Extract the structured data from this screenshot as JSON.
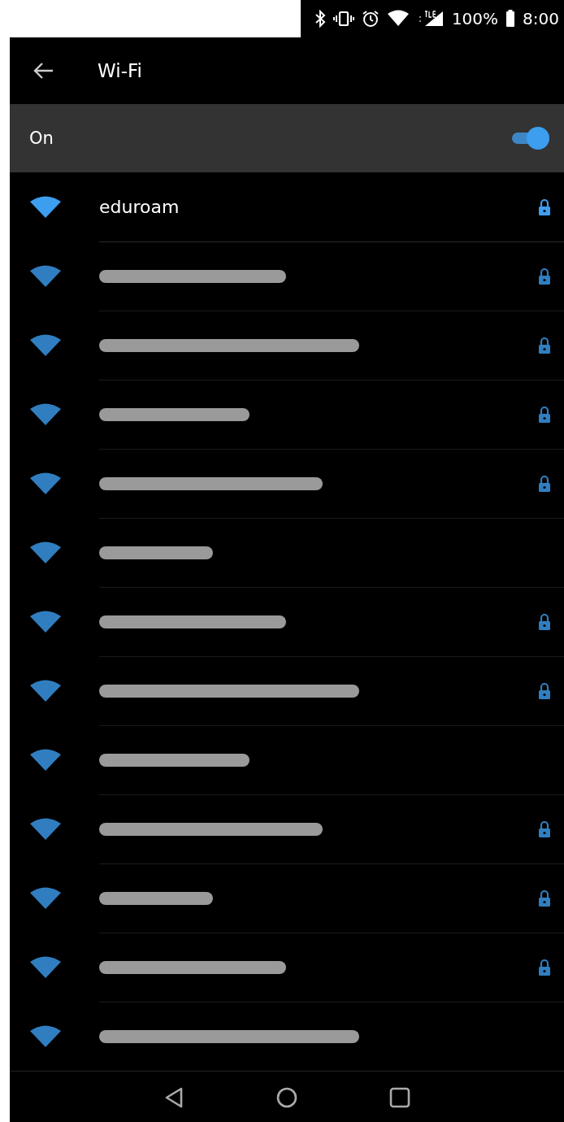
{
  "status_bar": {
    "battery": "100%",
    "time": "8:00"
  },
  "app_bar": {
    "title": "Wi-Fi"
  },
  "master_switch": {
    "label": "On",
    "on": true
  },
  "networks": [
    {
      "name": "eduroam",
      "secured": true,
      "redacted": false
    },
    {
      "secured": true,
      "redacted": true
    },
    {
      "secured": true,
      "redacted": true
    },
    {
      "secured": true,
      "redacted": true
    },
    {
      "secured": true,
      "redacted": true
    },
    {
      "secured": false,
      "redacted": true
    },
    {
      "secured": true,
      "redacted": true
    },
    {
      "secured": true,
      "redacted": true
    },
    {
      "secured": false,
      "redacted": true
    },
    {
      "secured": true,
      "redacted": true
    },
    {
      "secured": true,
      "redacted": true
    },
    {
      "secured": true,
      "redacted": true
    },
    {
      "secured": false,
      "redacted": true
    }
  ]
}
